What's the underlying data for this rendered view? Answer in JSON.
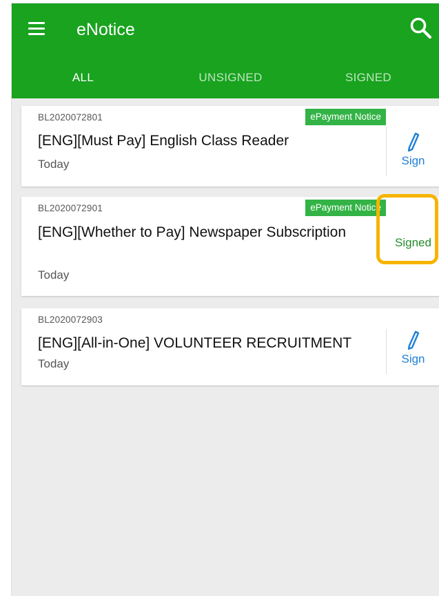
{
  "app": {
    "title": "eNotice",
    "menu_icon": "hamburger-menu-icon",
    "search_icon": "search-icon",
    "header_color": "#19a31f"
  },
  "tabs": [
    {
      "label": "ALL",
      "active": true
    },
    {
      "label": "UNSIGNED",
      "active": false
    },
    {
      "label": "SIGNED",
      "active": false
    }
  ],
  "notices": [
    {
      "reference": "BL2020072801",
      "badge": "ePayment Notice",
      "title": "[ENG][Must Pay] English Class Reader",
      "date": "Today",
      "action_label": "Sign",
      "status": "unsigned"
    },
    {
      "reference": "BL2020072901",
      "badge": "ePayment Notice",
      "title": "[ENG][Whether to Pay] Newspaper Subscription",
      "date": "Today",
      "action_label": "Signed",
      "status": "signed"
    },
    {
      "reference": "BL2020072903",
      "badge": "",
      "title": "[ENG][All-in-One] VOLUNTEER RECRUITMENT",
      "date": "Today",
      "action_label": "Sign",
      "status": "unsigned"
    }
  ],
  "colors": {
    "badge": "#33b346",
    "sign": "#1f7fd6",
    "signed": "#238b2b",
    "highlight": "#f6b400"
  }
}
